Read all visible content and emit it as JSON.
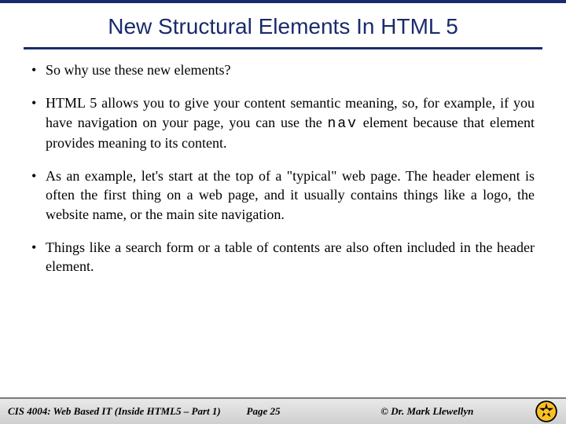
{
  "title": "New Structural Elements In HTML 5",
  "bullets": [
    {
      "text": "So why use these new elements?"
    },
    {
      "text_pre": "HTML 5 allows you to give your content semantic meaning, so, for example, if you have navigation on your page, you can use the ",
      "code": "nav",
      "text_post": " element because that element provides meaning to its content."
    },
    {
      "text": " As an example, let's start at the top of a \"typical\" web page. The header element is often the first thing on a web page, and it usually contains things like a logo, the website name, or the main site navigation."
    },
    {
      "text": "Things like a search form or a table of contents are also often included in the header element."
    }
  ],
  "footer": {
    "course": "CIS 4004: Web Based IT (Inside HTML5 – Part 1)",
    "page": "Page 25",
    "author": "© Dr. Mark Llewellyn"
  }
}
